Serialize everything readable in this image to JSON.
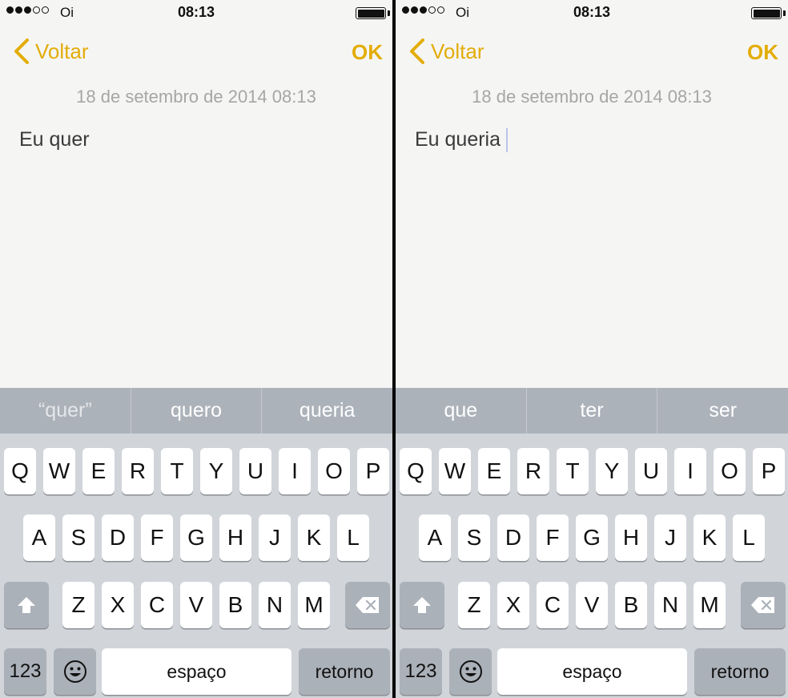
{
  "screens": [
    {
      "status": {
        "signal_filled": 3,
        "signal_total": 5,
        "carrier": "Oi",
        "time": "08:13"
      },
      "nav": {
        "back_label": "Voltar",
        "ok_label": "OK"
      },
      "note": {
        "date": "18 de setembro de 2014 08:13",
        "text": "Eu quer",
        "caret": false
      },
      "suggestions": [
        {
          "label": "“quer”",
          "muted": true
        },
        {
          "label": "quero",
          "muted": false
        },
        {
          "label": "queria",
          "muted": false
        }
      ]
    },
    {
      "status": {
        "signal_filled": 3,
        "signal_total": 5,
        "carrier": "Oi",
        "time": "08:13"
      },
      "nav": {
        "back_label": "Voltar",
        "ok_label": "OK"
      },
      "note": {
        "date": "18 de setembro de 2014 08:13",
        "text": "Eu queria",
        "caret": true
      },
      "suggestions": [
        {
          "label": "que",
          "muted": false
        },
        {
          "label": "ter",
          "muted": false
        },
        {
          "label": "ser",
          "muted": false
        }
      ]
    }
  ],
  "keyboard": {
    "rows": [
      [
        "Q",
        "W",
        "E",
        "R",
        "T",
        "Y",
        "U",
        "I",
        "O",
        "P"
      ],
      [
        "A",
        "S",
        "D",
        "F",
        "G",
        "H",
        "J",
        "K",
        "L"
      ],
      [
        "Z",
        "X",
        "C",
        "V",
        "B",
        "N",
        "M"
      ]
    ],
    "numbers_label": "123",
    "space_label": "espaço",
    "return_label": "retorno"
  },
  "colors": {
    "accent": "#e3ad08",
    "suggestion_bar": "#acb2ba",
    "keyboard_bg": "#d1d4d9",
    "note_bg": "#f5f5f4"
  }
}
